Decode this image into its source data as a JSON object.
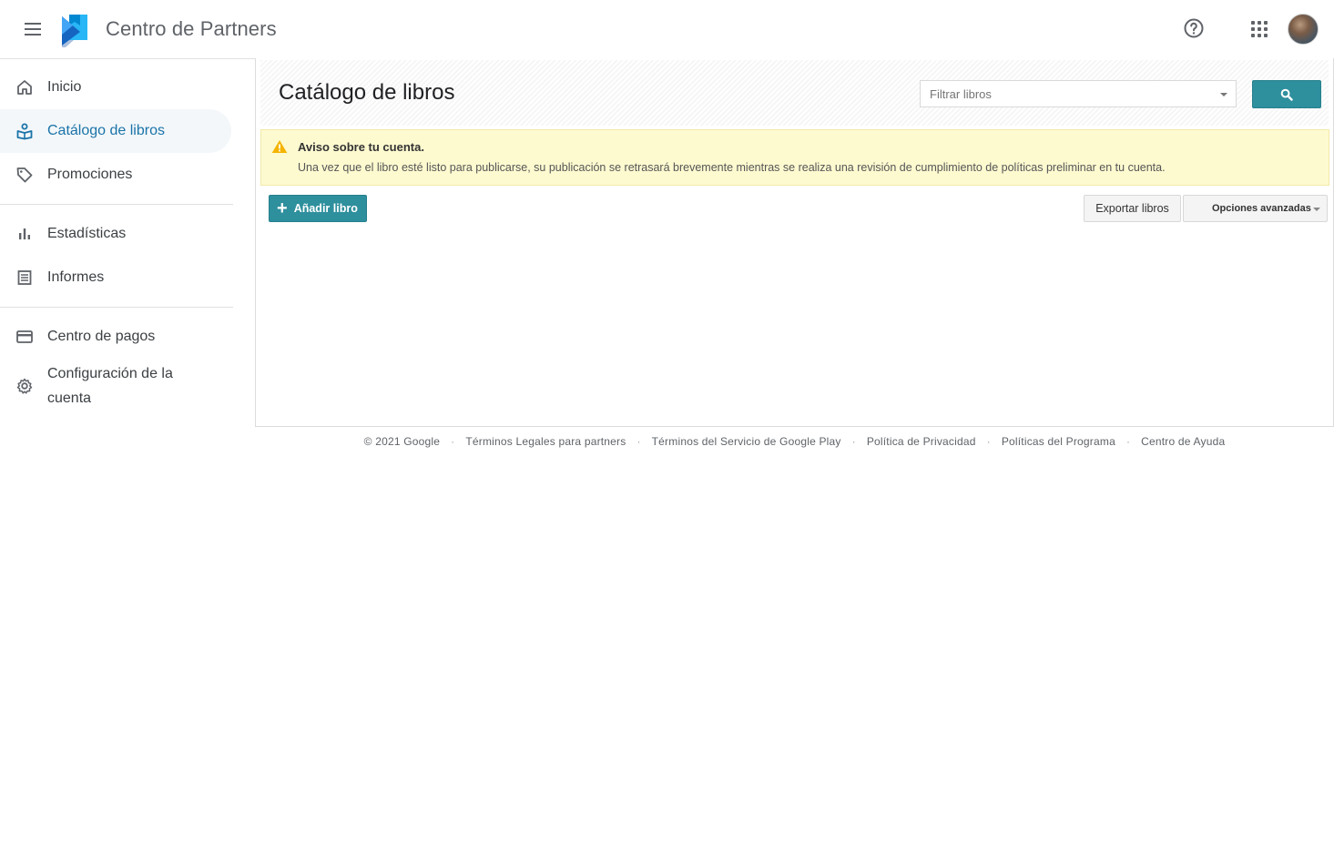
{
  "header": {
    "app_title": "Centro de Partners",
    "icons": {
      "menu": "hamburger-icon",
      "logo": "google-play-books-logo",
      "help": "help-icon",
      "apps": "apps-grid-icon",
      "avatar": "avatar"
    }
  },
  "sidebar": {
    "items": [
      {
        "label": "Inicio",
        "icon": "home-icon",
        "active": false
      },
      {
        "label": "Catálogo de libros",
        "icon": "book-catalog-icon",
        "active": true
      },
      {
        "label": "Promociones",
        "icon": "tag-icon",
        "active": false
      },
      {
        "label": "Estadísticas",
        "icon": "bar-chart-icon",
        "active": false
      },
      {
        "label": "Informes",
        "icon": "report-icon",
        "active": false
      },
      {
        "label": "Centro de pagos",
        "icon": "credit-card-icon",
        "active": false
      },
      {
        "label": "Configuración de la cuenta",
        "icon": "gear-icon",
        "active": false
      }
    ]
  },
  "main": {
    "title": "Catálogo de libros",
    "filter": {
      "placeholder": "Filtrar libros"
    },
    "warning": {
      "title": "Aviso sobre tu cuenta.",
      "text": "Una vez que el libro esté listo para publicarse, su publicación se retrasará brevemente mientras se realiza una revisión de cumplimiento de políticas preliminar en tu cuenta."
    },
    "buttons": {
      "add": "Añadir libro",
      "export": "Exportar libros",
      "advanced": "Opciones avanzadas"
    }
  },
  "footer": {
    "copyright": "© 2021 Google",
    "links": [
      "Términos Legales para partners",
      "Términos del Servicio de Google Play",
      "Política de Privacidad",
      "Políticas del Programa",
      "Centro de Ayuda"
    ],
    "separator": "·"
  },
  "colors": {
    "accent": "#2e8f9d",
    "active_nav_text": "#1a73a8",
    "active_nav_bg": "#f3f7fa",
    "warning_bg": "#fdfad0",
    "warning_icon": "#f4b400"
  }
}
